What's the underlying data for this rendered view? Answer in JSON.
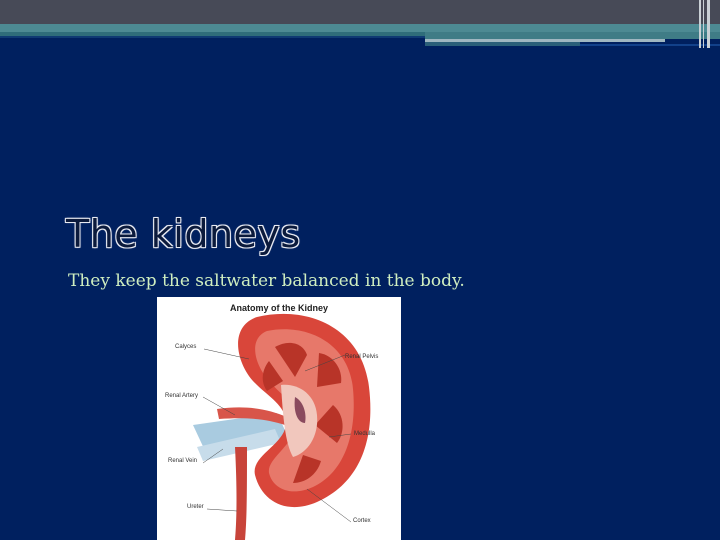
{
  "slide": {
    "title": "The kidneys",
    "subtitle": "They keep the saltwater balanced in the body."
  },
  "figure": {
    "title": "Anatomy of the Kidney",
    "labels": {
      "calyces": "Calyces",
      "renal_artery": "Renal Artery",
      "renal_vein": "Renal Vein",
      "ureter": "Ureter",
      "renal_pelvis": "Renal Pelvis",
      "medulla": "Medulla",
      "cortex": "Cortex"
    }
  },
  "colors": {
    "background": "#00205f",
    "title_fill": "#0b1a3c",
    "subtitle": "#cfeec0",
    "kidney": "#d9463a"
  }
}
